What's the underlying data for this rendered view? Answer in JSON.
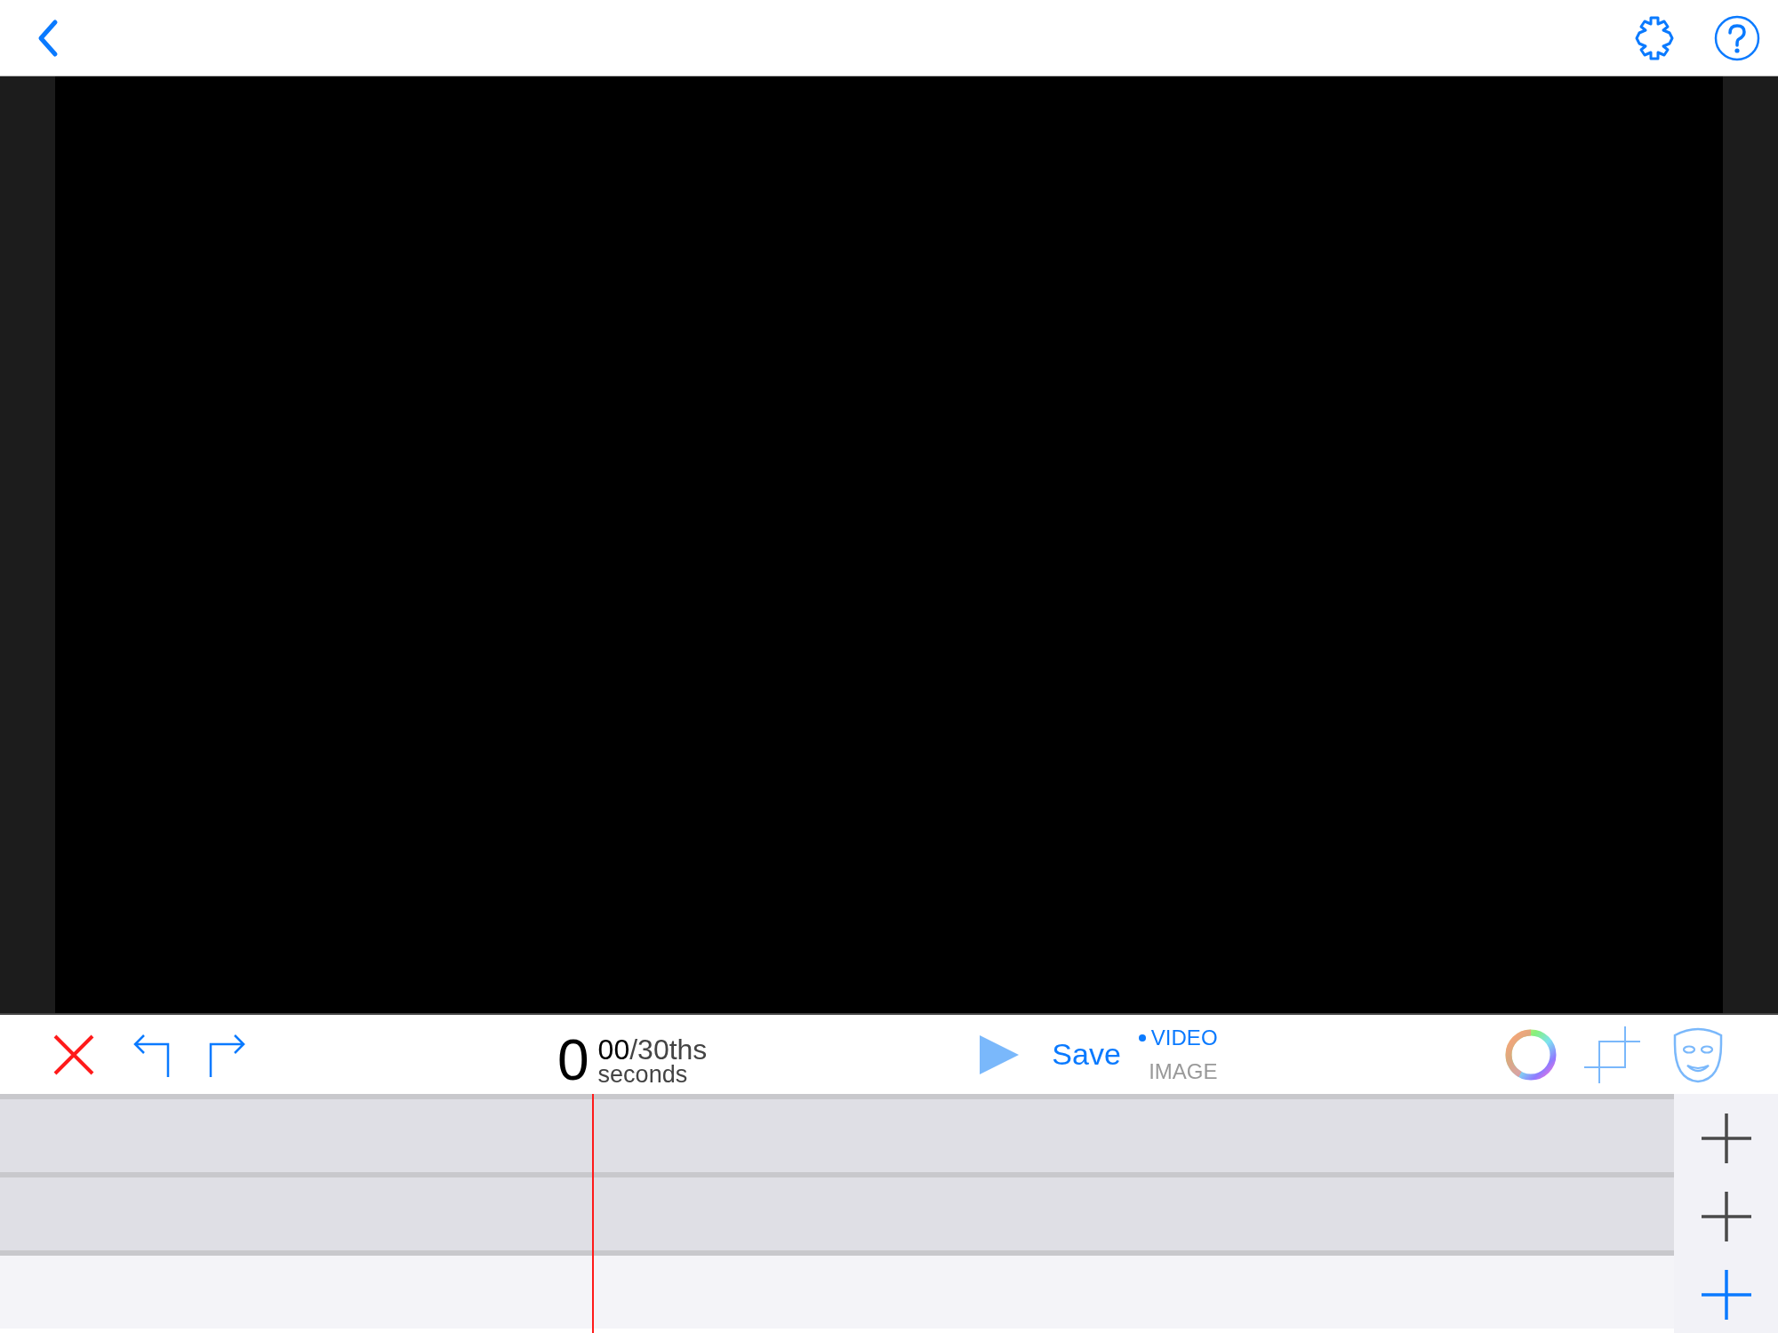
{
  "timecode": {
    "seconds": "0",
    "fraction": "00",
    "fraction_unit": "/30ths",
    "unit": "seconds"
  },
  "save_button": "Save",
  "modes": [
    {
      "label": "VIDEO",
      "selected": true
    },
    {
      "label": "IMAGE",
      "selected": false
    }
  ],
  "tracks": [
    {
      "selected": false
    },
    {
      "selected": false
    },
    {
      "selected": true
    }
  ]
}
